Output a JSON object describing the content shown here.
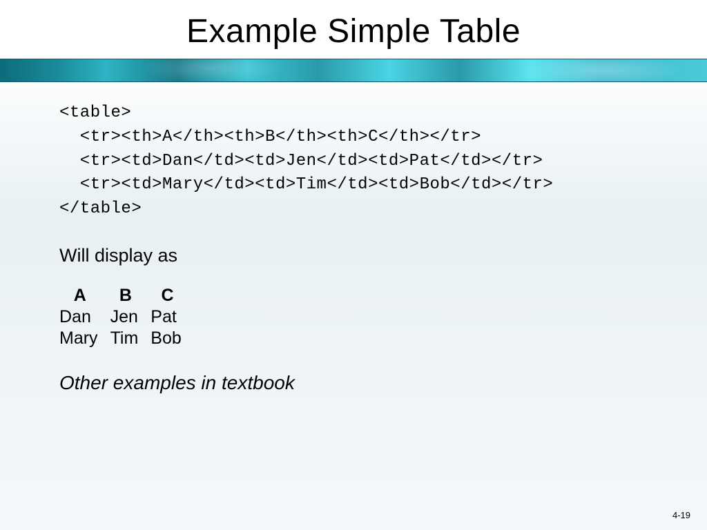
{
  "title": "Example Simple Table",
  "code": {
    "line1": "<table>",
    "line2": "  <tr><th>A</th><th>B</th><th>C</th></tr>",
    "line3": "  <tr><td>Dan</td><td>Jen</td><td>Pat</td></tr>",
    "line4": "  <tr><td>Mary</td><td>Tim</td><td>Bob</td></tr>",
    "line5": "</table>"
  },
  "will_display_label": "Will display as",
  "table": {
    "headers": {
      "c0": "A",
      "c1": "B",
      "c2": "C"
    },
    "rows": [
      {
        "c0": "Dan",
        "c1": "Jen",
        "c2": "Pat"
      },
      {
        "c0": "Mary",
        "c1": "Tim",
        "c2": "Bob"
      }
    ]
  },
  "other_examples_label": "Other examples in textbook",
  "page_number": "4-19"
}
